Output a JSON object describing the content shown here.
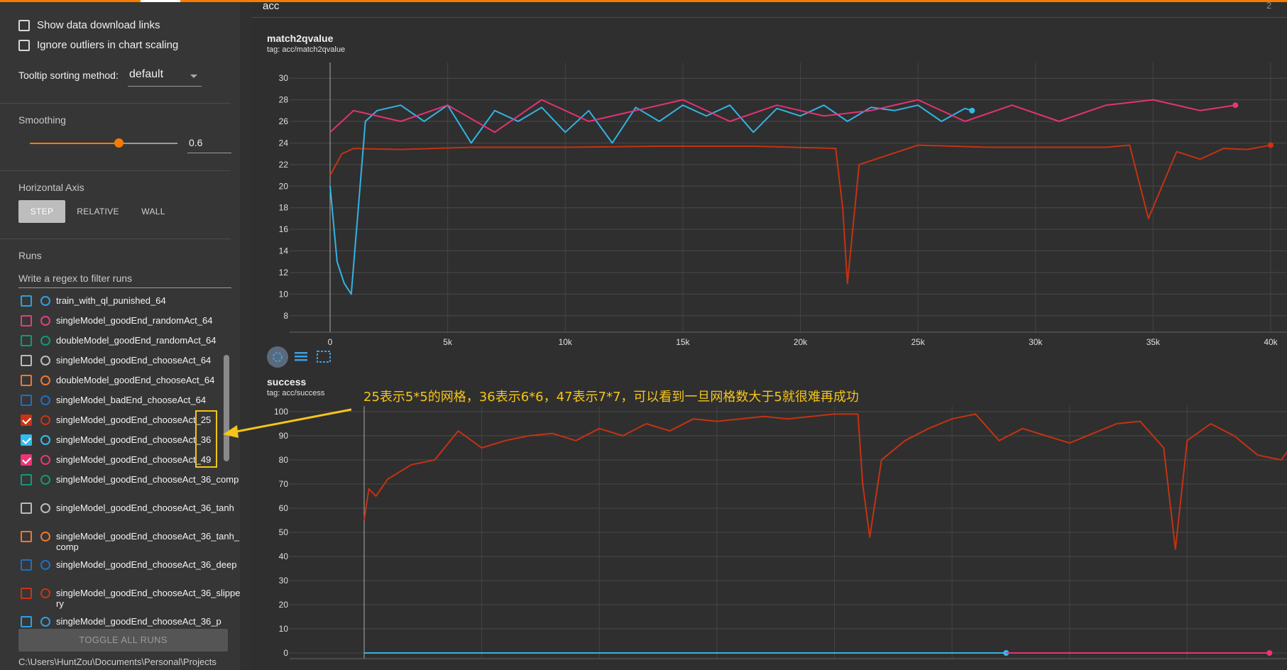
{
  "sidebar": {
    "show_download_links": "Show data download links",
    "ignore_outliers": "Ignore outliers in chart scaling",
    "tooltip_label": "Tooltip sorting method:",
    "tooltip_value": "default",
    "smoothing_title": "Smoothing",
    "smoothing_value": "0.6",
    "smoothing_fraction": 0.6,
    "axis_title": "Horizontal Axis",
    "axis_buttons": [
      "STEP",
      "RELATIVE",
      "WALL"
    ],
    "runs_title": "Runs",
    "filter_placeholder": "Write a regex to filter runs",
    "runs": [
      {
        "name": "train_with_ql_punished_64",
        "color": "#2f9fe0",
        "checked": false
      },
      {
        "name": "singleModel_goodEnd_randomAct_64",
        "color": "#e0407a",
        "checked": false
      },
      {
        "name": "doubleModel_goodEnd_randomAct_64",
        "color": "#119977",
        "checked": false
      },
      {
        "name": "singleModel_goodEnd_chooseAct_64",
        "color": "#bbbbbb",
        "checked": false
      },
      {
        "name": "doubleModel_goodEnd_chooseAct_64",
        "color": "#ee7733",
        "checked": false
      },
      {
        "name": "singleModel_badEnd_chooseAct_64",
        "color": "#1f6fc0",
        "checked": false
      },
      {
        "name": "singleModel_goodEnd_chooseAct_25",
        "color": "#cc3311",
        "checked": true
      },
      {
        "name": "singleModel_goodEnd_chooseAct_36",
        "color": "#33bbee",
        "checked": true
      },
      {
        "name": "singleModel_goodEnd_chooseAct_49",
        "color": "#ee3377",
        "checked": true
      },
      {
        "name": "singleModel_goodEnd_chooseAct_36_comp",
        "color": "#119977",
        "checked": false
      },
      {
        "name": "singleModel_goodEnd_chooseAct_36_tanh",
        "color": "#bbbbbb",
        "checked": false
      },
      {
        "name": "singleModel_goodEnd_chooseAct_36_tanh_comp",
        "color": "#ee7733",
        "checked": false
      },
      {
        "name": "singleModel_goodEnd_chooseAct_36_deep",
        "color": "#1f6fc0",
        "checked": false
      },
      {
        "name": "singleModel_goodEnd_chooseAct_36_slippery",
        "color": "#cc3311",
        "checked": false
      },
      {
        "name": "singleModel_goodEnd_chooseAct_36_p",
        "color": "#2f9fe0",
        "checked": false
      }
    ],
    "toggle_all": "TOGGLE ALL RUNS",
    "path": "C:\\Users\\HuntZou\\Documents\\Personal\\Projects"
  },
  "main": {
    "group_title": "acc",
    "group_count": "2",
    "annotation": "25表示5*5的网格，36表示6*6，47表示7*7，可以看到一旦网格数大于5就很难再成功"
  },
  "colors": {
    "accent": "#f57c00",
    "run_25": "#cc3311",
    "run_36": "#33bbee",
    "run_49": "#ee3377",
    "annotation": "#f5c518"
  },
  "icons": [
    "fit-domain-icon",
    "data-table-icon",
    "expand-chart-icon"
  ],
  "chart_data": [
    {
      "type": "line",
      "title": "match2qvalue",
      "subtitle": "tag: acc/match2qvalue",
      "xlim": [
        0,
        40000
      ],
      "ylim": [
        7,
        31
      ],
      "x_ticks": [
        "0",
        "5k",
        "10k",
        "15k",
        "20k",
        "25k",
        "30k",
        "35k",
        "40k"
      ],
      "y_ticks": [
        "8",
        "10",
        "12",
        "14",
        "16",
        "18",
        "20",
        "22",
        "24",
        "26",
        "28",
        "30"
      ],
      "series": [
        {
          "color": "#cc3311",
          "x": [
            0,
            500,
            1000,
            3000,
            6000,
            10000,
            14000,
            18000,
            21500,
            21800,
            22000,
            22500,
            25000,
            28000,
            31000,
            33000,
            34000,
            34800,
            36000,
            37000,
            38000,
            39000,
            40000
          ],
          "y": [
            21,
            23,
            23.5,
            23.4,
            23.6,
            23.6,
            23.7,
            23.7,
            23.5,
            18,
            11,
            22,
            23.8,
            23.6,
            23.6,
            23.6,
            23.8,
            17,
            23.2,
            22.5,
            23.5,
            23.4,
            23.8
          ]
        },
        {
          "color": "#33bbee",
          "x": [
            0,
            300,
            600,
            900,
            1200,
            1500,
            2000,
            3000,
            4000,
            5000,
            6000,
            7000,
            8000,
            9000,
            10000,
            11000,
            12000,
            13000,
            14000,
            15000,
            16000,
            17000,
            18000,
            19000,
            20000,
            21000,
            22000,
            23000,
            24000,
            25000,
            26000,
            27000,
            27300
          ],
          "y": [
            20,
            13,
            11,
            10,
            18,
            26,
            27,
            27.5,
            26,
            27.5,
            24,
            27,
            26,
            27.3,
            25,
            27,
            24,
            27.3,
            26,
            27.5,
            26.5,
            27.5,
            25,
            27.2,
            26.5,
            27.5,
            26,
            27.3,
            27,
            27.5,
            26,
            27.2,
            27
          ]
        },
        {
          "color": "#ee3377",
          "x": [
            0,
            1000,
            3000,
            5000,
            7000,
            9000,
            11000,
            13000,
            15000,
            17000,
            19000,
            21000,
            23000,
            25000,
            27000,
            29000,
            31000,
            33000,
            35000,
            37000,
            38500
          ],
          "y": [
            25,
            27,
            26,
            27.5,
            25,
            28,
            26,
            27,
            28,
            26,
            27.5,
            26.5,
            27,
            28,
            26,
            27.5,
            26,
            27.5,
            28,
            27,
            27.5
          ]
        }
      ]
    },
    {
      "type": "line",
      "title": "success",
      "subtitle": "tag: acc/success",
      "xlim": [
        0,
        40000
      ],
      "ylim": [
        0,
        100
      ],
      "y_ticks": [
        "0",
        "10",
        "20",
        "30",
        "40",
        "50",
        "60",
        "70",
        "80",
        "90",
        "100"
      ],
      "series": [
        {
          "color": "#cc3311",
          "x": [
            0,
            200,
            500,
            1000,
            2000,
            3000,
            4000,
            5000,
            6000,
            7000,
            8000,
            9000,
            10000,
            11000,
            12000,
            13000,
            14000,
            15000,
            16000,
            17000,
            18000,
            19000,
            20000,
            21000,
            21200,
            21500,
            22000,
            23000,
            24000,
            25000,
            26000,
            27000,
            28000,
            29000,
            30000,
            31000,
            32000,
            33000,
            34000,
            34500,
            35000,
            36000,
            37000,
            38000,
            39000,
            40000
          ],
          "y": [
            55,
            68,
            65,
            72,
            78,
            80,
            92,
            85,
            88,
            90,
            91,
            88,
            93,
            90,
            95,
            92,
            97,
            96,
            97,
            98,
            97,
            98,
            99,
            99,
            70,
            48,
            80,
            88,
            93,
            97,
            99,
            88,
            93,
            90,
            87,
            91,
            95,
            96,
            85,
            43,
            88,
            95,
            90,
            82,
            80,
            93
          ]
        },
        {
          "color": "#33bbee",
          "x": [
            0,
            27300
          ],
          "y": [
            0,
            0
          ]
        },
        {
          "color": "#ee3377",
          "x": [
            27300,
            38500
          ],
          "y": [
            0,
            0
          ]
        }
      ]
    }
  ]
}
